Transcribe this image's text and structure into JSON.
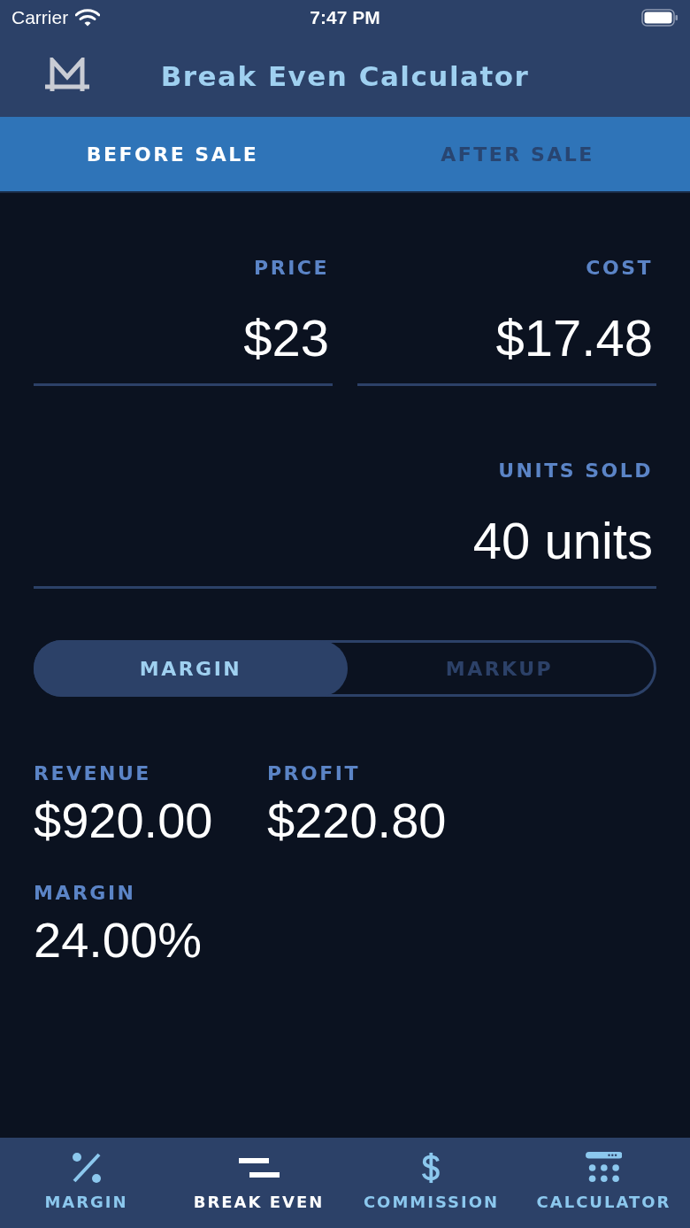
{
  "status_bar": {
    "carrier": "Carrier",
    "time": "7:47 PM"
  },
  "header": {
    "title": "Break Even Calculator"
  },
  "tabs": [
    {
      "label": "BEFORE SALE",
      "selected": true
    },
    {
      "label": "AFTER SALE",
      "selected": false
    }
  ],
  "inputs": [
    {
      "label": "PRICE",
      "value": "$23"
    },
    {
      "label": "COST",
      "value": "$17.48"
    },
    {
      "label": "UNITS SOLD",
      "value": "40 units"
    }
  ],
  "mode_toggle": [
    {
      "label": "MARGIN",
      "selected": true
    },
    {
      "label": "MARKUP",
      "selected": false
    }
  ],
  "results": [
    {
      "label": "REVENUE",
      "value": "$920.00"
    },
    {
      "label": "PROFIT",
      "value": "$220.80"
    },
    {
      "label": "MARGIN",
      "value": "24.00%"
    }
  ],
  "bottom_nav": [
    {
      "kind": "percent",
      "label": "MARGIN",
      "selected": false
    },
    {
      "kind": "break-even",
      "label": "BREAK EVEN",
      "selected": true
    },
    {
      "kind": "dollar",
      "label": "COMMISSION",
      "selected": false
    },
    {
      "kind": "calculator",
      "label": "CALCULATOR",
      "selected": false
    }
  ]
}
